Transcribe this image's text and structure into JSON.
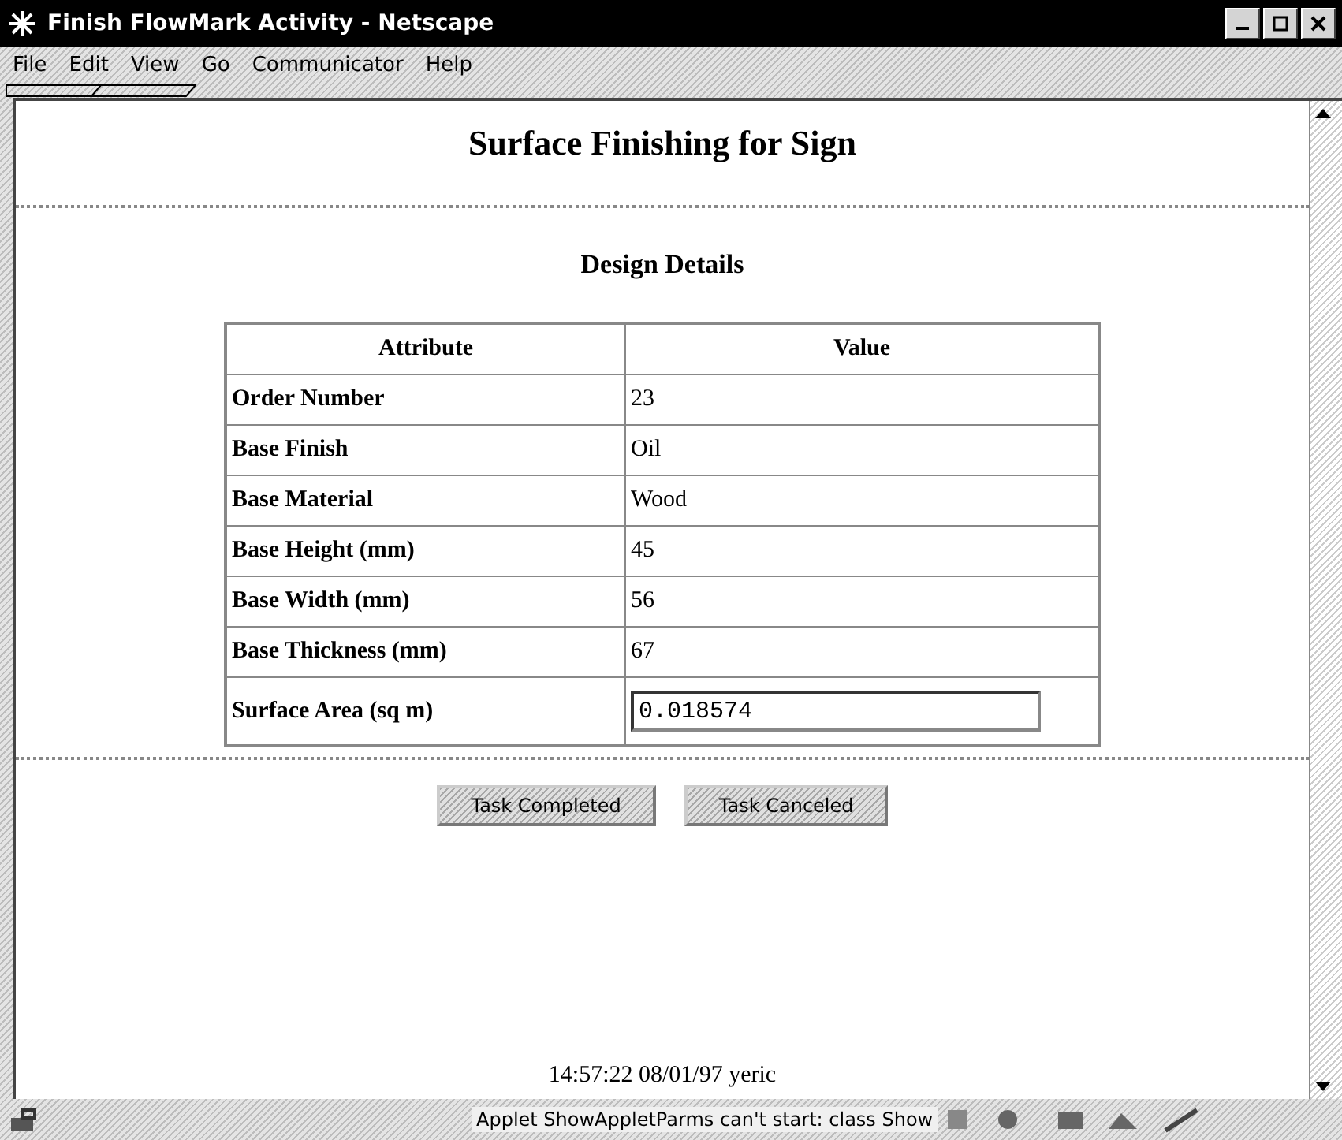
{
  "window": {
    "title": "Finish FlowMark Activity - Netscape"
  },
  "menu": [
    "File",
    "Edit",
    "View",
    "Go",
    "Communicator",
    "Help"
  ],
  "page": {
    "heading": "Surface Finishing for Sign",
    "section_title": "Design Details",
    "table": {
      "columns": [
        "Attribute",
        "Value"
      ],
      "rows": [
        {
          "kind": "text",
          "attribute": "Order Number",
          "value": "23"
        },
        {
          "kind": "text",
          "attribute": "Base Finish",
          "value": "Oil"
        },
        {
          "kind": "text",
          "attribute": "Base Material",
          "value": "Wood"
        },
        {
          "kind": "text",
          "attribute": "Base Height (mm)",
          "value": "45"
        },
        {
          "kind": "text",
          "attribute": "Base Width (mm)",
          "value": "56"
        },
        {
          "kind": "text",
          "attribute": "Base Thickness (mm)",
          "value": "67"
        },
        {
          "kind": "field",
          "attribute": "Surface Area (sq m)",
          "value": "0.018574"
        }
      ]
    },
    "buttons": [
      "Task Completed",
      "Task Canceled"
    ],
    "footer": "14:57:22 08/01/97 yeric"
  },
  "status_bar": {
    "message": "Applet ShowAppletParms can't start: class Show"
  }
}
